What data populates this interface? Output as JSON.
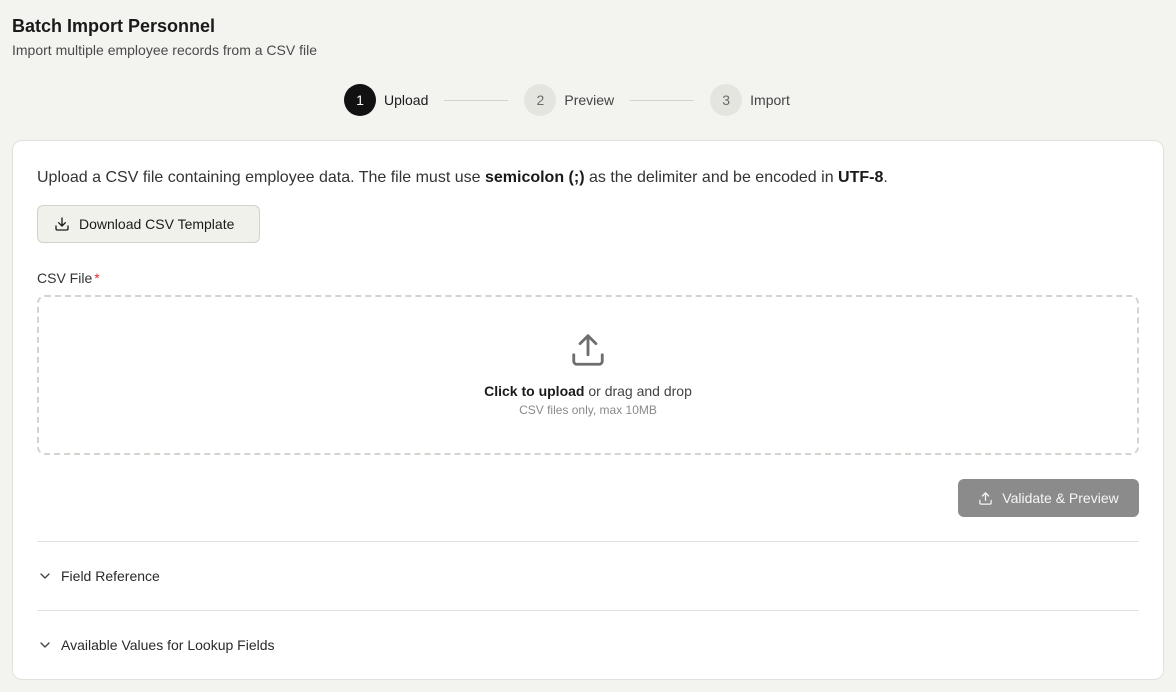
{
  "header": {
    "title": "Batch Import Personnel",
    "subtitle": "Import multiple employee records from a CSV file"
  },
  "stepper": {
    "steps": [
      {
        "number": "1",
        "label": "Upload",
        "state": "active"
      },
      {
        "number": "2",
        "label": "Preview",
        "state": "inactive"
      },
      {
        "number": "3",
        "label": "Import",
        "state": "inactive"
      }
    ]
  },
  "upload": {
    "intro_prefix": "Upload a CSV file containing employee data. The file must use ",
    "intro_delimiter": "semicolon (;)",
    "intro_middle": " as the delimiter and be encoded in ",
    "intro_encoding": "UTF-8",
    "intro_suffix": ".",
    "download_template_label": "Download CSV Template",
    "field_label": "CSV File",
    "required_marker": "*",
    "dropzone_action": "Click to upload",
    "dropzone_text": " or drag and drop",
    "dropzone_hint": "CSV files only, max 10MB",
    "validate_label": "Validate & Preview"
  },
  "accordions": [
    {
      "label": "Field Reference",
      "expanded": false
    },
    {
      "label": "Available Values for Lookup Fields",
      "expanded": false
    }
  ],
  "icons": {
    "download": "download-icon",
    "upload": "upload-icon",
    "chevron": "chevron-down-icon"
  },
  "colors": {
    "active_step": "#111111",
    "inactive_step": "#e5e5e0",
    "required": "#e03030",
    "validate_button": "#8b8b8b"
  }
}
